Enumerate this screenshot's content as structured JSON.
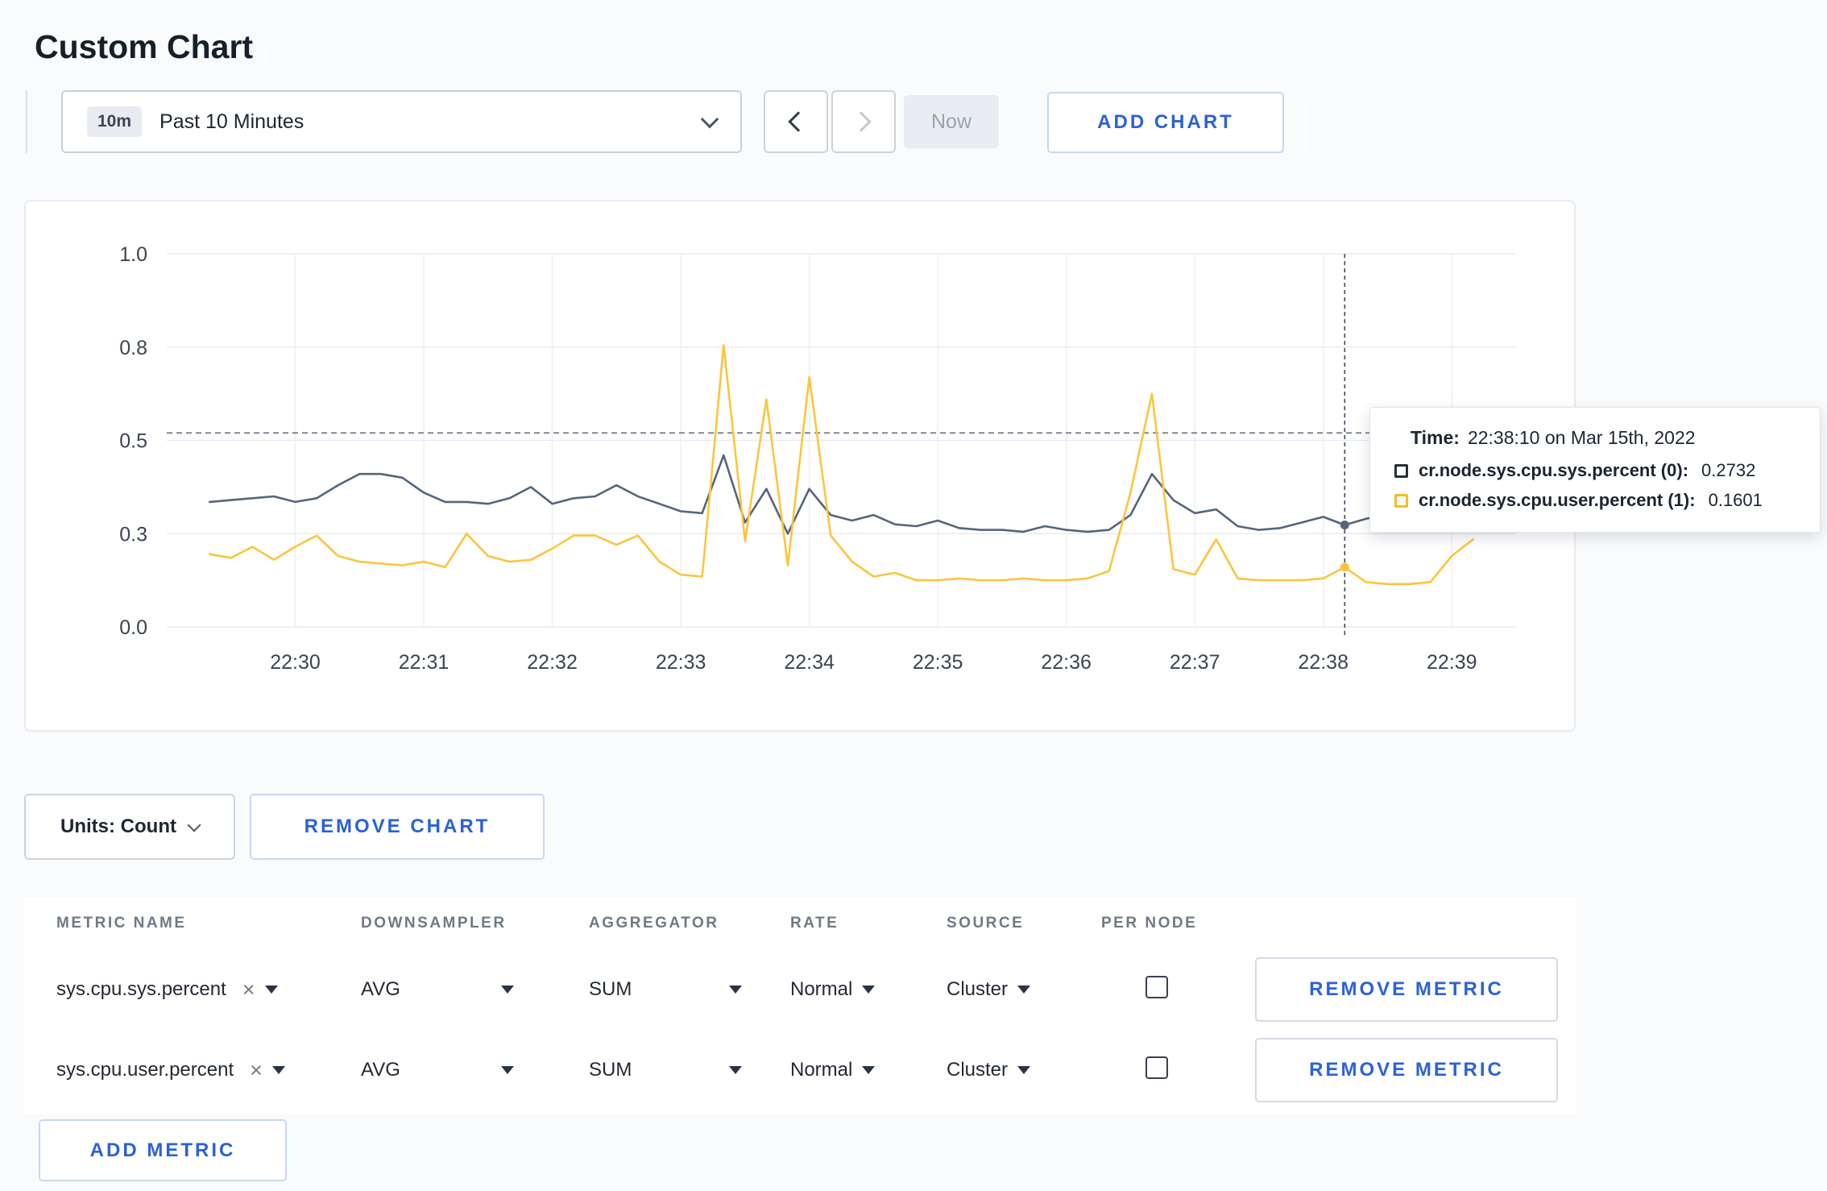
{
  "header": {
    "title": "Custom Chart"
  },
  "icons": {
    "close": "×"
  },
  "colors": {
    "accent_blue": "#2b62d9",
    "series_sys": "#55657e",
    "series_user": "#fdc53d",
    "grid": "#e9ebef"
  },
  "toolbar": {
    "time_range": {
      "badge": "10m",
      "label": "Past 10 Minutes"
    },
    "now_label": "Now",
    "add_chart_label": "ADD CHART"
  },
  "chart_data": {
    "type": "line",
    "x_axis": {
      "min": 29.0,
      "max": 39.5,
      "ticks": [
        30,
        31,
        32,
        33,
        34,
        35,
        36,
        37,
        38,
        39
      ],
      "tick_labels": [
        "22:30",
        "22:31",
        "22:32",
        "22:33",
        "22:34",
        "22:35",
        "22:36",
        "22:37",
        "22:38",
        "22:39"
      ]
    },
    "y_axis": {
      "min": 0,
      "max": 1,
      "ticks": [
        0,
        0.25,
        0.5,
        0.75,
        1.0
      ],
      "tick_labels": [
        "0.0",
        "0.3",
        "0.5",
        "0.8",
        "1.0"
      ]
    },
    "threshold": 0.52,
    "crosshair_minutes": 38.1667,
    "series": [
      {
        "name": "cr.node.sys.cpu.sys.percent",
        "color": "#55657e",
        "start_minutes": 29.3333,
        "step_seconds": 10,
        "values": [
          0.335,
          0.34,
          0.345,
          0.35,
          0.335,
          0.345,
          0.38,
          0.41,
          0.41,
          0.4,
          0.36,
          0.335,
          0.335,
          0.33,
          0.345,
          0.375,
          0.33,
          0.345,
          0.35,
          0.38,
          0.35,
          0.33,
          0.31,
          0.305,
          0.46,
          0.28,
          0.37,
          0.25,
          0.37,
          0.3,
          0.285,
          0.3,
          0.275,
          0.27,
          0.285,
          0.265,
          0.26,
          0.26,
          0.255,
          0.27,
          0.26,
          0.255,
          0.26,
          0.3,
          0.41,
          0.34,
          0.305,
          0.315,
          0.27,
          0.26,
          0.265,
          0.28,
          0.295,
          0.2732,
          0.29,
          0.3,
          0.285,
          0.29,
          0.3,
          0.325
        ]
      },
      {
        "name": "cr.node.sys.cpu.user.percent",
        "color": "#fdc53d",
        "start_minutes": 29.3333,
        "step_seconds": 10,
        "values": [
          0.195,
          0.185,
          0.215,
          0.18,
          0.215,
          0.245,
          0.19,
          0.175,
          0.17,
          0.165,
          0.175,
          0.16,
          0.25,
          0.19,
          0.175,
          0.18,
          0.21,
          0.245,
          0.245,
          0.22,
          0.245,
          0.175,
          0.14,
          0.135,
          0.755,
          0.23,
          0.61,
          0.165,
          0.67,
          0.245,
          0.175,
          0.135,
          0.145,
          0.125,
          0.125,
          0.13,
          0.125,
          0.125,
          0.13,
          0.125,
          0.125,
          0.13,
          0.15,
          0.36,
          0.625,
          0.155,
          0.14,
          0.235,
          0.13,
          0.125,
          0.125,
          0.125,
          0.13,
          0.1601,
          0.12,
          0.115,
          0.115,
          0.12,
          0.19,
          0.235
        ]
      }
    ],
    "highlight_points": [
      {
        "series": 0,
        "minutes": 38.1667,
        "value": 0.2732
      },
      {
        "series": 1,
        "minutes": 38.1667,
        "value": 0.1601
      }
    ]
  },
  "tooltip": {
    "time_label": "Time:",
    "time_value": "22:38:10 on Mar 15th, 2022",
    "series": [
      {
        "label": "cr.node.sys.cpu.sys.percent (0):",
        "value": "0.2732",
        "swatch": "#24303f"
      },
      {
        "label": "cr.node.sys.cpu.user.percent (1):",
        "value": "0.1601",
        "swatch": "#f3bd27"
      }
    ]
  },
  "units": {
    "label": "Units: Count",
    "remove_chart_label": "REMOVE CHART"
  },
  "metrics": {
    "columns": [
      "METRIC NAME",
      "DOWNSAMPLER",
      "AGGREGATOR",
      "RATE",
      "SOURCE",
      "PER NODE"
    ],
    "rows": [
      {
        "name": "sys.cpu.sys.percent",
        "downsampler": "AVG",
        "aggregator": "SUM",
        "rate": "Normal",
        "source": "Cluster",
        "per_node": false,
        "remove_label": "REMOVE METRIC"
      },
      {
        "name": "sys.cpu.user.percent",
        "downsampler": "AVG",
        "aggregator": "SUM",
        "rate": "Normal",
        "source": "Cluster",
        "per_node": false,
        "remove_label": "REMOVE METRIC"
      }
    ],
    "add_metric_label": "ADD METRIC"
  }
}
